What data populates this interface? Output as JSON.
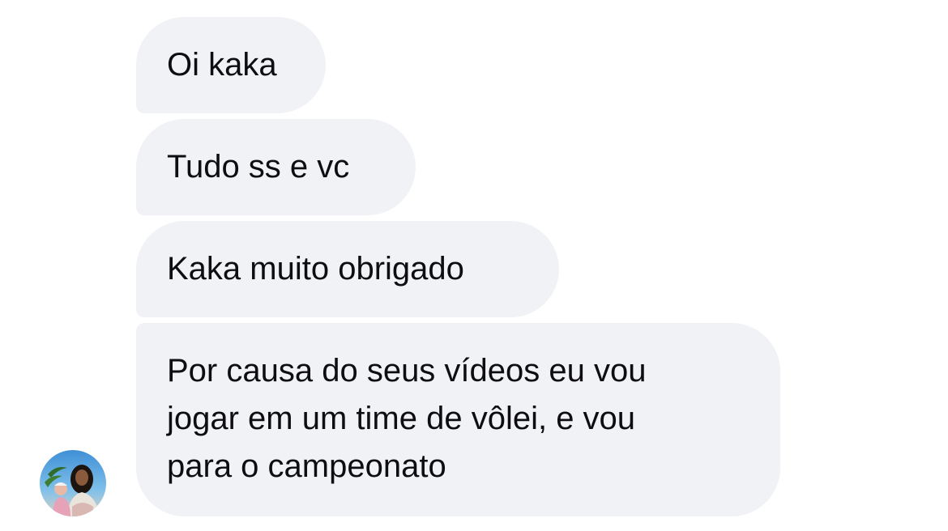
{
  "messages": [
    {
      "text": "Oi kaka"
    },
    {
      "text": "Tudo ss e vc"
    },
    {
      "text": "Kaka muito obrigado"
    },
    {
      "lines": [
        "Por causa do seus vídeos eu vou",
        "jogar em um time de vôlei, e vou",
        "para o campeonato"
      ]
    }
  ],
  "avatar": {
    "icon": "profile-photo"
  },
  "colors": {
    "bubble": "#f1f2f5",
    "text": "#0e0e10",
    "background": "#ffffff"
  }
}
